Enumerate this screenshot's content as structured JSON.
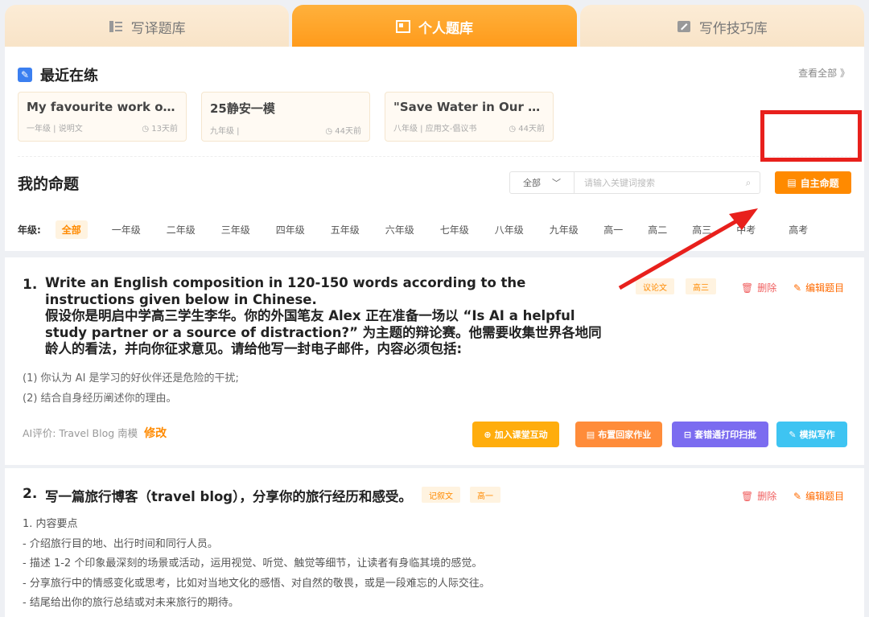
{
  "tabs": [
    {
      "label": "写译题库",
      "icon": "book-list-icon"
    },
    {
      "label": "个人题库",
      "icon": "image-frame-icon"
    },
    {
      "label": "写作技巧库",
      "icon": "pencil-card-icon"
    }
  ],
  "recent": {
    "title": "最近在练",
    "view_all": "查看全部 》",
    "cards": [
      {
        "title": "My favourite work of ...",
        "meta": "一年级 | 说明文",
        "time": "13天前"
      },
      {
        "title": "25静安一模",
        "meta": "九年级 |",
        "time": "44天前"
      },
      {
        "title": "\"Save Water in Our C...",
        "meta": "八年级 | 应用文-倡议书",
        "time": "44天前"
      }
    ]
  },
  "my_topics": {
    "title": "我的命题",
    "filter_selected": "全部",
    "search_placeholder": "请输入关键词搜索",
    "self_button": "自主命题",
    "grade_label": "年级:",
    "grades": [
      "全部",
      "一年级",
      "二年级",
      "三年级",
      "四年级",
      "五年级",
      "六年级",
      "七年级",
      "八年级",
      "九年级",
      "高一",
      "高二",
      "高三",
      "中考",
      "高考"
    ]
  },
  "questions": [
    {
      "num": "1.",
      "text_en": "Write an English composition in 120-150 words according to the instructions given below in Chinese.",
      "text_cn": "假设你是明启中学高三学生李华。你的外国笔友 Alex 正在准备一场以 “Is AI a helpful study partner or a source of distraction?” 为主题的辩论赛。他需要收集世界各地同龄人的看法，并向你征求意见。请给他写一封电子邮件，内容必须包括:",
      "tags": [
        "议论文",
        "高三"
      ],
      "lines": [
        "(1) 你认为 AI 是学习的好伙伴还是危险的干扰;",
        "(2) 结合自身经历阐述你的理由。"
      ],
      "ai_label": "AI评价: Travel Blog 南模",
      "ai_fix": "修改",
      "buttons": [
        "加入课堂互动",
        "布置回家作业",
        "套错通打印扫批",
        "模拟写作"
      ]
    },
    {
      "num": "2.",
      "title": "写一篇旅行博客（travel blog），分享你的旅行经历和感受。",
      "tags": [
        "记叙文",
        "高一"
      ],
      "lines": [
        "1. 内容要点",
        "- 介绍旅行目的地、出行时间和同行人员。",
        "- 描述 1-2 个印象最深刻的场景或活动，运用视觉、听觉、触觉等细节，让读者有身临其境的感觉。",
        "- 分享旅行中的情感变化或思考，比如对当地文化的感悟、对自然的敬畏，或是一段难忘的人际交往。",
        "- 结尾给出你的旅行总结或对未来旅行的期待。"
      ]
    }
  ],
  "actions": {
    "delete": "删除",
    "edit": "编辑题目"
  },
  "colors": {
    "accent": "#ff8a00",
    "highlight": "#e8201c",
    "btn1": "#ffad0d",
    "btn2": "#ff8c3a",
    "btn3": "#7b6cf0",
    "btn4": "#3ec4f2"
  }
}
